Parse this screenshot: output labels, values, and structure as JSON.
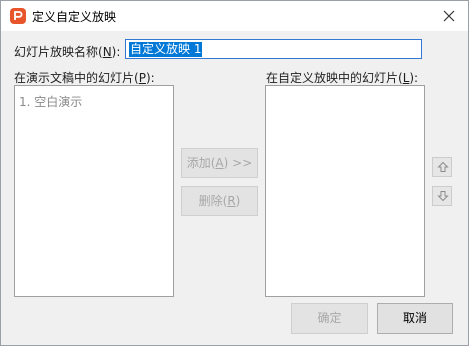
{
  "window": {
    "title": "定义自定义放映",
    "app_icon": "wps-presentation-icon",
    "close_icon": "close-icon"
  },
  "name_field": {
    "label_prefix": "幻灯片放映名称(",
    "label_key": "N",
    "label_suffix": "):",
    "value": "自定义放映 1"
  },
  "left_panel": {
    "label_prefix": "在演示文稿中的幻灯片(",
    "label_key": "P",
    "label_suffix": "):",
    "items": [
      "1. 空白演示"
    ]
  },
  "right_panel": {
    "label_prefix": "在自定义放映中的幻灯片(",
    "label_key": "L",
    "label_suffix": "):",
    "items": []
  },
  "buttons": {
    "add_prefix": "添加(",
    "add_key": "A",
    "add_suffix": ") >>",
    "remove_prefix": "删除(",
    "remove_key": "R",
    "remove_suffix": ")",
    "move_up_icon": "arrow-up-icon",
    "move_down_icon": "arrow-down-icon",
    "ok": "确定",
    "cancel": "取消"
  }
}
